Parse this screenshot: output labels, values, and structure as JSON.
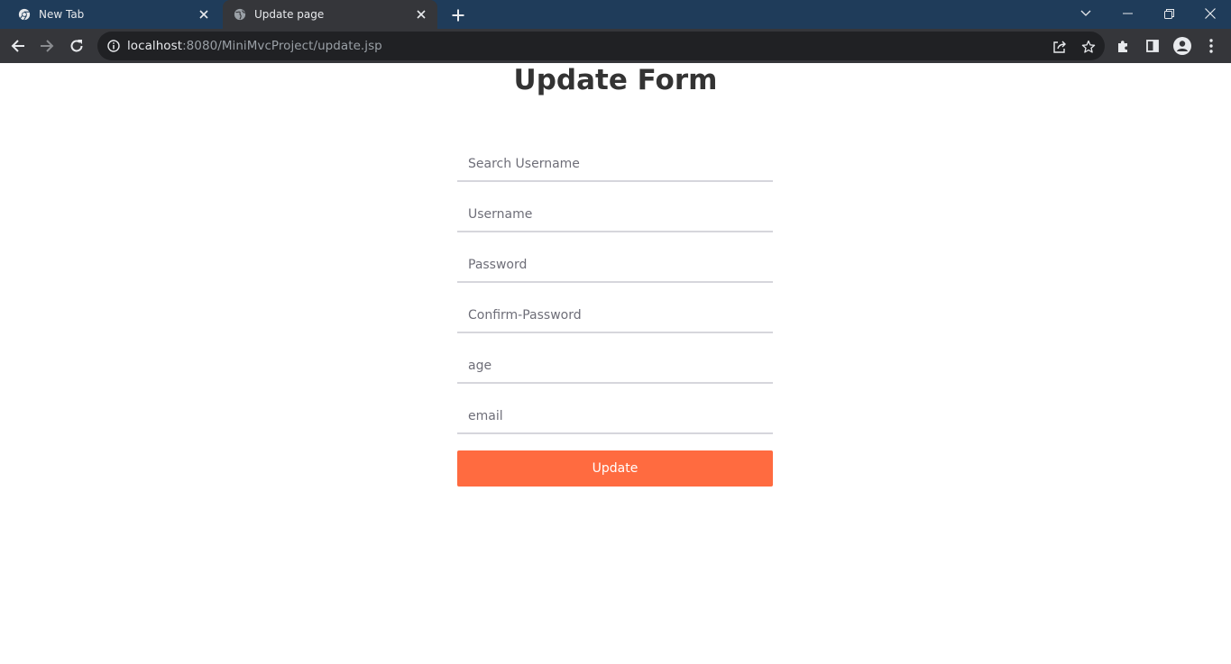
{
  "browser": {
    "tabs": [
      {
        "title": "New Tab",
        "favicon": "chrome-icon",
        "active": false
      },
      {
        "title": "Update page",
        "favicon": "globe-icon",
        "active": true
      }
    ],
    "address": {
      "host": "localhost",
      "rest": ":8080/MiniMvcProject/update.jsp"
    }
  },
  "page": {
    "title": "Update Form",
    "fields": [
      {
        "name": "search-username-input",
        "placeholder": "Search Username"
      },
      {
        "name": "username-input",
        "placeholder": "Username"
      },
      {
        "name": "password-input",
        "placeholder": "Password"
      },
      {
        "name": "confirm-password-input",
        "placeholder": "Confirm-Password"
      },
      {
        "name": "age-input",
        "placeholder": "age"
      },
      {
        "name": "email-input",
        "placeholder": "email"
      }
    ],
    "submit_label": "Update"
  },
  "colors": {
    "tabstrip": "#1f3c5a",
    "toolbar": "#35363a",
    "accent_button": "#ff6b40"
  }
}
